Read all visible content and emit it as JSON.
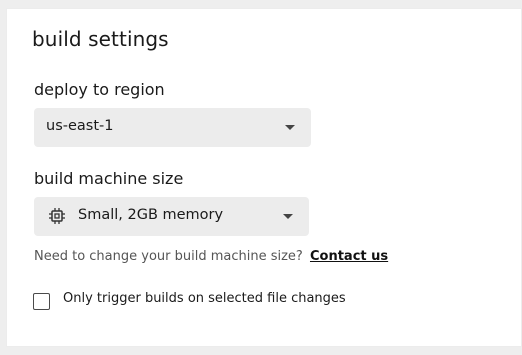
{
  "header": {
    "title": "build settings"
  },
  "region": {
    "label": "deploy to region",
    "selected": "us-east-1"
  },
  "machine": {
    "label": "build machine size",
    "selected": "Small, 2GB memory",
    "icon": "cpu-chip-icon"
  },
  "help": {
    "text": "Need to change your build machine size?",
    "link_label": "Contact us"
  },
  "file_changes": {
    "label": "Only trigger builds on selected file changes",
    "checked": false
  },
  "colors": {
    "page_background": "#eeeeee",
    "card_background": "#ffffff",
    "select_background": "#ececec",
    "text": "#1a1a1a",
    "muted_text": "#555555"
  }
}
